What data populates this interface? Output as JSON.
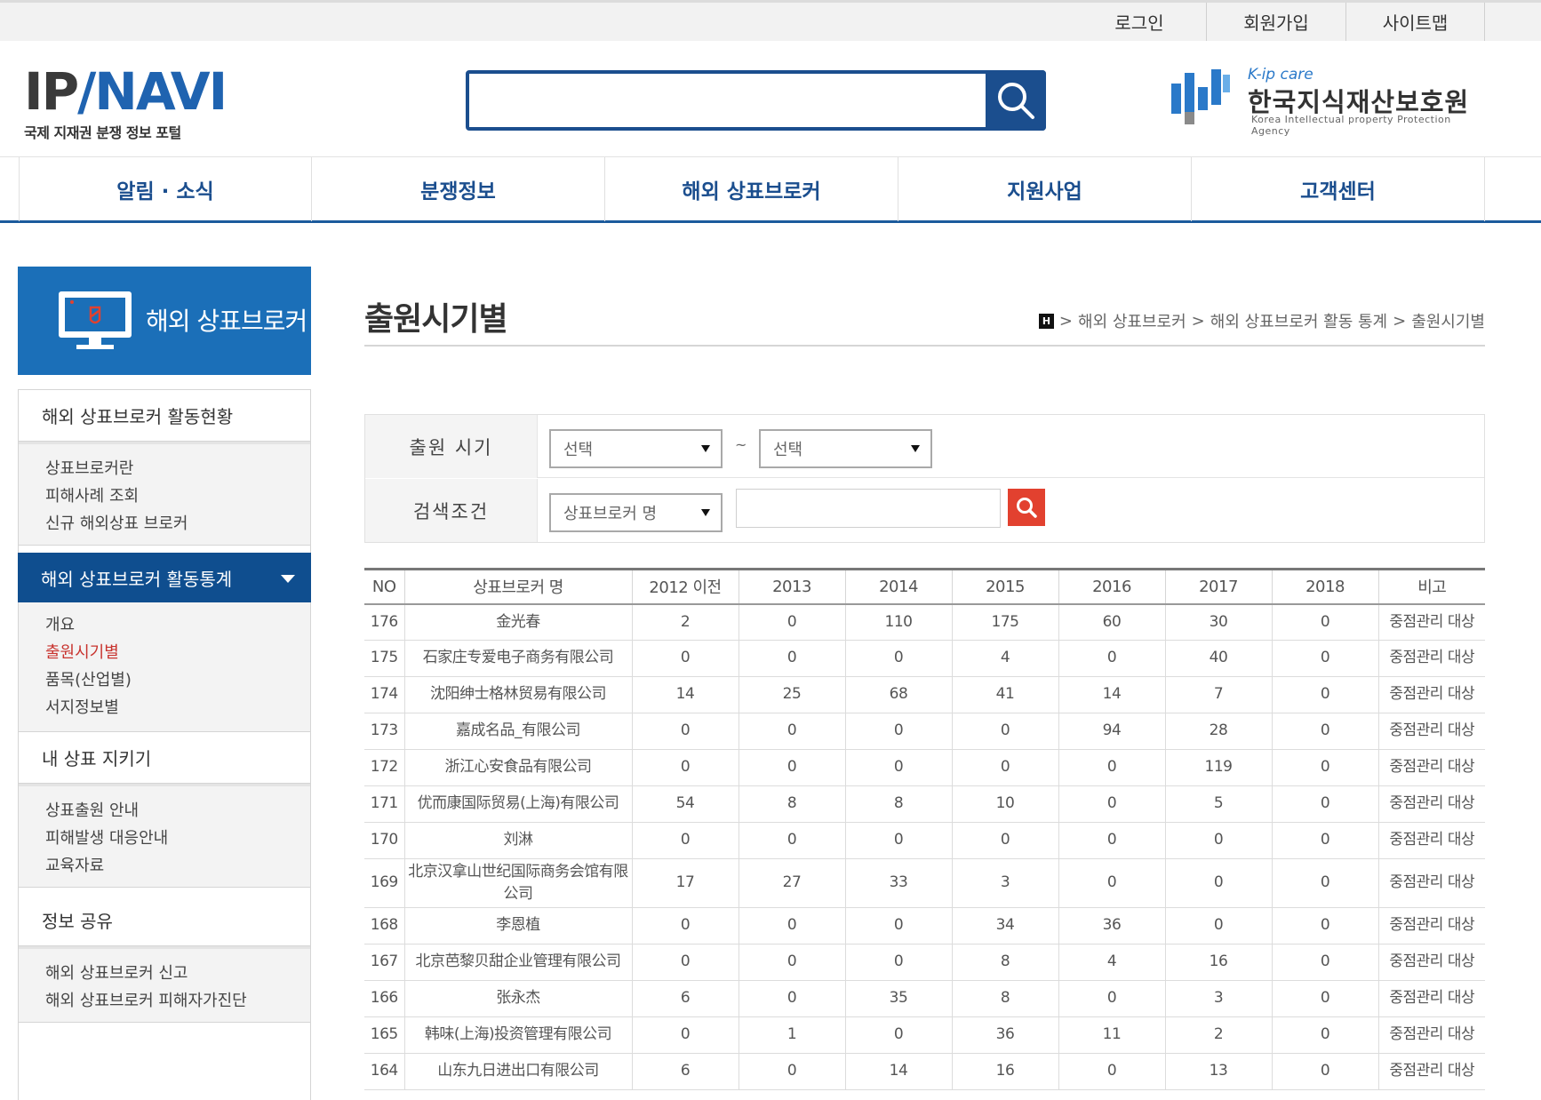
{
  "util": {
    "login": "로그인",
    "join": "회원가입",
    "sitemap": "사이트맵"
  },
  "logo": {
    "ip": "IP",
    "navi": "NAVI",
    "sub": "국제 지재권 분쟁 정보 포털"
  },
  "search": {
    "value": "",
    "placeholder": ""
  },
  "agency": {
    "kip": "K-ip care",
    "name": "한국지식재산보호원",
    "eng": "Korea Intellectual property Protection Agency"
  },
  "gnb": [
    "알림 · 소식",
    "분쟁정보",
    "해외 상표브로커",
    "지원사업",
    "고객센터"
  ],
  "sidebar": {
    "title": "해외 상표브로커",
    "cat1": "해외 상표브로커 활동현황",
    "cat1_items": [
      "상표브로커란",
      "피해사례 조회",
      "신규 해외상표 브로커"
    ],
    "cat2": "해외 상표브로커 활동통계",
    "cat2_items": [
      "개요",
      "출원시기별",
      "품목(산업별)",
      "서지정보별"
    ],
    "cat3": "내 상표 지키기",
    "cat3_items": [
      "상표출원 안내",
      "피해발생 대응안내",
      "교육자료"
    ],
    "cat4": "정보 공유",
    "cat4_items": [
      "해외 상표브로커 신고",
      "해외 상표브로커 피해자가진단"
    ]
  },
  "page": {
    "title": "출원시기별"
  },
  "breadcrumb": {
    "home": "H",
    "c1": "해외 상표브로커",
    "c2": "해외 상표브로커 활동 통계",
    "c3": "출원시기별",
    "sep": ">"
  },
  "filter": {
    "period_label": "출원 시기",
    "from": "선택",
    "tilde": "~",
    "to": "선택",
    "cond_label": "검색조건",
    "cond_select": "상표브로커 명",
    "keyword": ""
  },
  "table": {
    "headers": [
      "NO",
      "상표브로커 명",
      "2012 이전",
      "2013",
      "2014",
      "2015",
      "2016",
      "2017",
      "2018",
      "비고"
    ],
    "rows": [
      [
        "176",
        "金光春",
        "2",
        "0",
        "110",
        "175",
        "60",
        "30",
        "0",
        "중점관리 대상"
      ],
      [
        "175",
        "石家庄专爱电子商务有限公司",
        "0",
        "0",
        "0",
        "4",
        "0",
        "40",
        "0",
        "중점관리 대상"
      ],
      [
        "174",
        "沈阳绅士格林贸易有限公司",
        "14",
        "25",
        "68",
        "41",
        "14",
        "7",
        "0",
        "중점관리 대상"
      ],
      [
        "173",
        "嘉成名品_有限公司",
        "0",
        "0",
        "0",
        "0",
        "94",
        "28",
        "0",
        "중점관리 대상"
      ],
      [
        "172",
        "浙江心安食品有限公司",
        "0",
        "0",
        "0",
        "0",
        "0",
        "119",
        "0",
        "중점관리 대상"
      ],
      [
        "171",
        "优而康国际贸易(上海)有限公司",
        "54",
        "8",
        "8",
        "10",
        "0",
        "5",
        "0",
        "중점관리 대상"
      ],
      [
        "170",
        "刘淋",
        "0",
        "0",
        "0",
        "0",
        "0",
        "0",
        "0",
        "중점관리 대상"
      ],
      [
        "169",
        "北京汉拿山世纪国际商务会馆有限公司",
        "17",
        "27",
        "33",
        "3",
        "0",
        "0",
        "0",
        "중점관리 대상"
      ],
      [
        "168",
        "李恩植",
        "0",
        "0",
        "0",
        "34",
        "36",
        "0",
        "0",
        "중점관리 대상"
      ],
      [
        "167",
        "北京芭黎贝甜企业管理有限公司",
        "0",
        "0",
        "0",
        "8",
        "4",
        "16",
        "0",
        "중점관리 대상"
      ],
      [
        "166",
        "张永杰",
        "6",
        "0",
        "35",
        "8",
        "0",
        "3",
        "0",
        "중점관리 대상"
      ],
      [
        "165",
        "韩味(上海)投资管理有限公司",
        "0",
        "1",
        "0",
        "36",
        "11",
        "2",
        "0",
        "중점관리 대상"
      ],
      [
        "164",
        "山东九日进出口有限公司",
        "6",
        "0",
        "14",
        "16",
        "0",
        "13",
        "0",
        "중점관리 대상"
      ]
    ]
  }
}
